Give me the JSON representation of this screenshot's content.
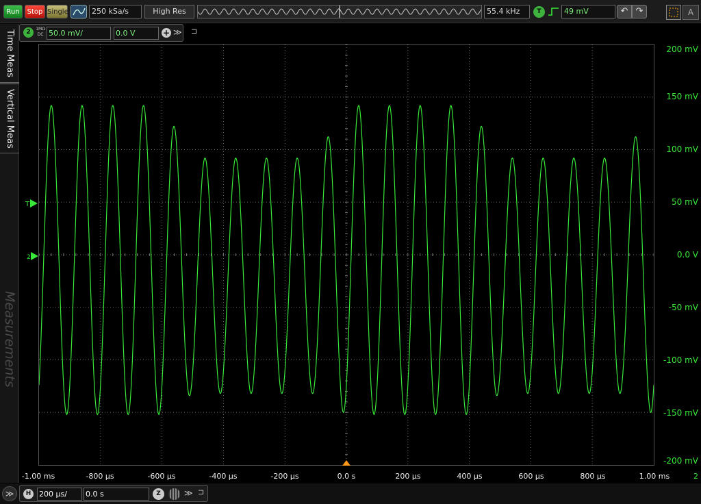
{
  "toolbar": {
    "run_label": "Run",
    "stop_label": "Stop",
    "single_label": "Single",
    "sample_rate": "250 kSa/s",
    "acq_mode": "High Res",
    "frequency": "55.4 kHz",
    "trigger_badge": "T",
    "trigger_level": "49 mV",
    "undo_icon": "undo-icon",
    "redo_icon": "redo-icon"
  },
  "channel": {
    "number": "2",
    "coupling": "1MΩ DC",
    "scale": "50.0 mV/",
    "offset": "0.0 V",
    "color": "#38e838"
  },
  "side_tabs": [
    "Time Meas",
    "Vertical Meas",
    "Measurements"
  ],
  "y_axis": {
    "labels": [
      "200 mV",
      "150 mV",
      "100 mV",
      "50 mV",
      "0.0 V",
      "-50 mV",
      "-100 mV",
      "-150 mV",
      "-200 mV"
    ]
  },
  "x_axis": {
    "labels": [
      "-1.00 ms",
      "-800 µs",
      "-600 µs",
      "-400 µs",
      "-200 µs",
      "0.0 s",
      "200 µs",
      "400 µs",
      "600 µs",
      "800 µs",
      "1.00 ms"
    ]
  },
  "scroll_indicator": "2",
  "horizontal": {
    "badge": "H",
    "scale": "200 µs/",
    "position": "0.0 s",
    "zoom_badge": "Z"
  },
  "chart_data": {
    "type": "line",
    "xlabel": "",
    "ylabel": "",
    "xlim_us": [
      -1000,
      1000
    ],
    "ylim_mV": [
      -200,
      200
    ],
    "grid": true,
    "series": [
      {
        "color": "#38e838",
        "waveform": "sine",
        "frequency_kHz": 10,
        "x_us": [
          -1000,
          -900,
          -600,
          -500,
          -100,
          0,
          400,
          500,
          900,
          1000
        ],
        "amplitude_mV": [
          147,
          147,
          147,
          112,
          112,
          147,
          147,
          112,
          112,
          147
        ],
        "offset_mV": [
          -5,
          -5,
          -5,
          -20,
          -20,
          -5,
          -5,
          -20,
          -20,
          -5
        ]
      }
    ]
  }
}
